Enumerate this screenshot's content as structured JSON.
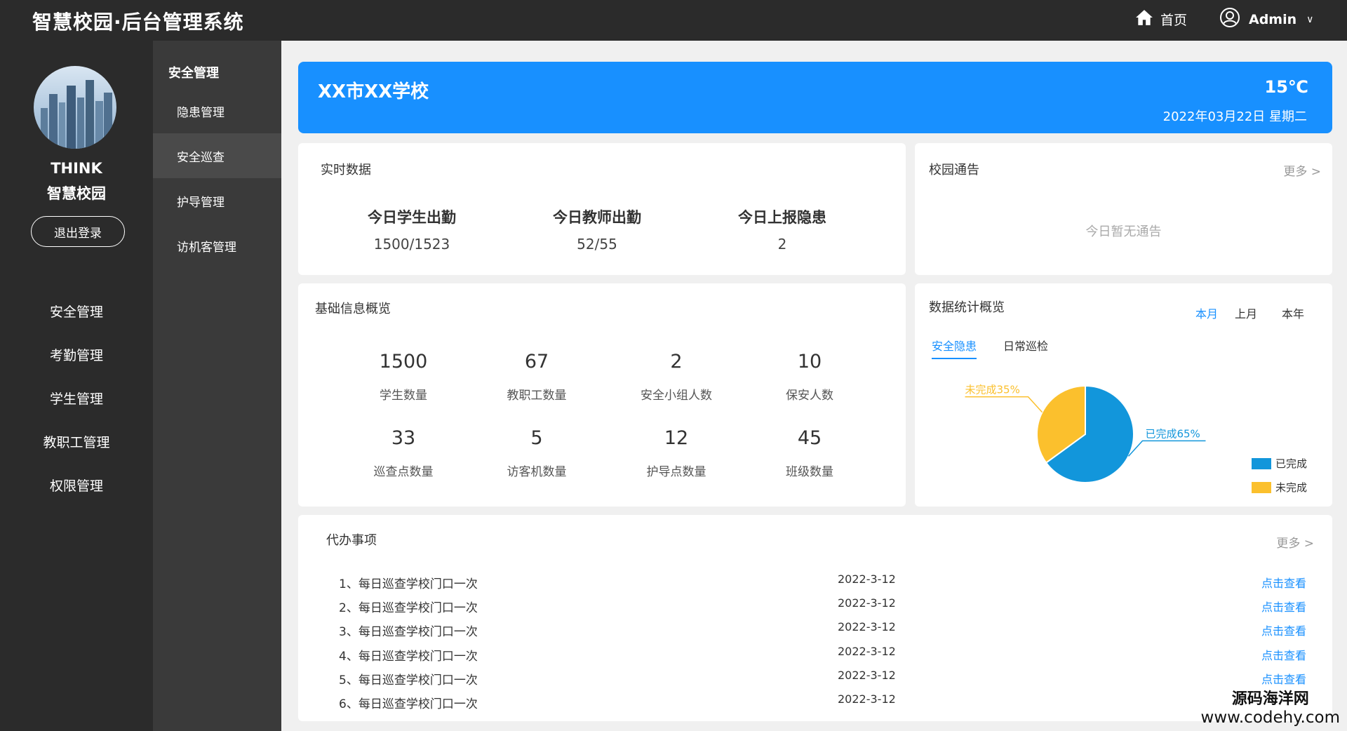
{
  "header": {
    "brand": "智慧校园·后台管理系统",
    "home_label": "首页",
    "user_label": "Admin",
    "caret": "∨"
  },
  "profile": {
    "name_line1": "THINK",
    "name_line2": "智慧校园",
    "logout_label": "退出登录"
  },
  "nav": {
    "items": [
      {
        "label": "安全管理"
      },
      {
        "label": "考勤管理"
      },
      {
        "label": "学生管理"
      },
      {
        "label": "教职工管理"
      },
      {
        "label": "权限管理"
      }
    ]
  },
  "subnav": {
    "header": "安全管理",
    "items": [
      {
        "label": "隐患管理"
      },
      {
        "label": "安全巡查"
      },
      {
        "label": "护导管理"
      },
      {
        "label": "访机客管理"
      }
    ]
  },
  "banner": {
    "school": "XX市XX学校",
    "temperature": "15℃",
    "date": "2022年03月22日  星期二"
  },
  "realtime": {
    "title": "实时数据",
    "items": [
      {
        "label": "今日学生出勤",
        "value": "1500/1523"
      },
      {
        "label": "今日教师出勤",
        "value": "52/55"
      },
      {
        "label": "今日上报隐患",
        "value": "2"
      }
    ]
  },
  "notice": {
    "title": "校园通告",
    "more": "更多 >",
    "empty": "今日暂无通告"
  },
  "basic_info": {
    "title": "基础信息概览",
    "stats": [
      {
        "value": "1500",
        "label": "学生数量"
      },
      {
        "value": "67",
        "label": "教职工数量"
      },
      {
        "value": "2",
        "label": "安全小组人数"
      },
      {
        "value": "10",
        "label": "保安人数"
      },
      {
        "value": "33",
        "label": "巡查点数量"
      },
      {
        "value": "5",
        "label": "访客机数量"
      },
      {
        "value": "12",
        "label": "护导点数量"
      },
      {
        "value": "45",
        "label": "班级数量"
      }
    ]
  },
  "stats_overview": {
    "title": "数据统计概览",
    "period_tabs": [
      "本月",
      "上月",
      "本年"
    ],
    "active_period": "本月",
    "type_tabs": [
      "安全隐患",
      "日常巡检"
    ],
    "active_type": "安全隐患",
    "colors": {
      "done": "#1296db",
      "undone": "#fbc02d"
    }
  },
  "chart_data": {
    "type": "pie",
    "slices": [
      {
        "name": "已完成",
        "value": 65,
        "label": "已完成65%"
      },
      {
        "name": "未完成",
        "value": 35,
        "label": "未完成35%"
      }
    ],
    "legend": [
      "已完成",
      "未完成"
    ],
    "legend_position": "bottom-right"
  },
  "todo": {
    "title": "代办事项",
    "more": "更多 >",
    "items": [
      {
        "title": "1、每日巡查学校门口一次",
        "date": "2022-3-12",
        "link": "点击查看"
      },
      {
        "title": "2、每日巡查学校门口一次",
        "date": "2022-3-12",
        "link": "点击查看"
      },
      {
        "title": "3、每日巡查学校门口一次",
        "date": "2022-3-12",
        "link": "点击查看"
      },
      {
        "title": "4、每日巡查学校门口一次",
        "date": "2022-3-12",
        "link": "点击查看"
      },
      {
        "title": "5、每日巡查学校门口一次",
        "date": "2022-3-12",
        "link": "点击查看"
      },
      {
        "title": "6、每日巡查学校门口一次",
        "date": "2022-3-12",
        "link": ""
      }
    ]
  },
  "watermark": {
    "cn": "源码海洋网",
    "url": "www.codehy.com"
  }
}
